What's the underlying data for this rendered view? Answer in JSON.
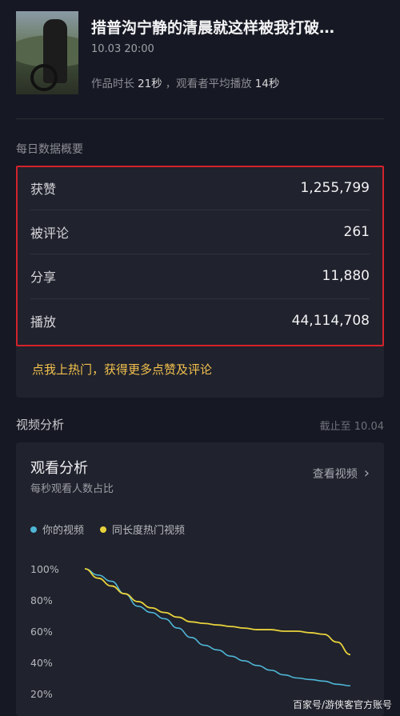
{
  "video": {
    "title": "措普沟宁静的清晨就这样被我打破…",
    "date": "10.03 20:00",
    "duration_label": "作品时长",
    "duration_value": "21秒",
    "avg_play_label": "，观看者平均播放",
    "avg_play_value": "14秒"
  },
  "daily_overview": {
    "section_title": "每日数据概要",
    "stats": [
      {
        "label": "获赞",
        "value": "1,255,799"
      },
      {
        "label": "被评论",
        "value": "261"
      },
      {
        "label": "分享",
        "value": "11,880"
      },
      {
        "label": "播放",
        "value": "44,114,708"
      }
    ],
    "promo_text": "点我上热门，获得更多点赞及评论",
    "highlight_color": "#d3232b"
  },
  "video_analysis": {
    "section_title": "视频分析",
    "cutoff_text": "截止至 10.04"
  },
  "watch_analysis": {
    "title": "观看分析",
    "subtitle": "每秒观看人数占比",
    "view_video_label": "查看视频",
    "chevron_icon": "chevron-right-icon"
  },
  "chart_data": {
    "type": "line",
    "ylabel": "",
    "xlabel": "",
    "y_ticks": [
      "100%",
      "80%",
      "60%",
      "40%",
      "20%"
    ],
    "ylim": [
      20,
      100
    ],
    "x": [
      0,
      1,
      2,
      3,
      4,
      5,
      6,
      7,
      8,
      9,
      10,
      11,
      12,
      13,
      14,
      15,
      16,
      17,
      18,
      19,
      20
    ],
    "series": [
      {
        "name": "你的视频",
        "color": "#4fb6d6",
        "values": [
          100,
          96,
          92,
          84,
          76,
          72,
          68,
          62,
          56,
          51,
          48,
          44,
          41,
          38,
          35,
          32,
          30,
          29,
          28,
          26,
          25
        ]
      },
      {
        "name": "同长度热门视频",
        "color": "#e8d23c",
        "values": [
          100,
          94,
          89,
          84,
          79,
          75,
          72,
          69,
          66,
          65,
          64,
          63,
          62,
          61,
          61,
          60,
          60,
          59,
          58,
          53,
          45
        ]
      }
    ]
  },
  "watermark": "百家号/游侠客官方账号"
}
